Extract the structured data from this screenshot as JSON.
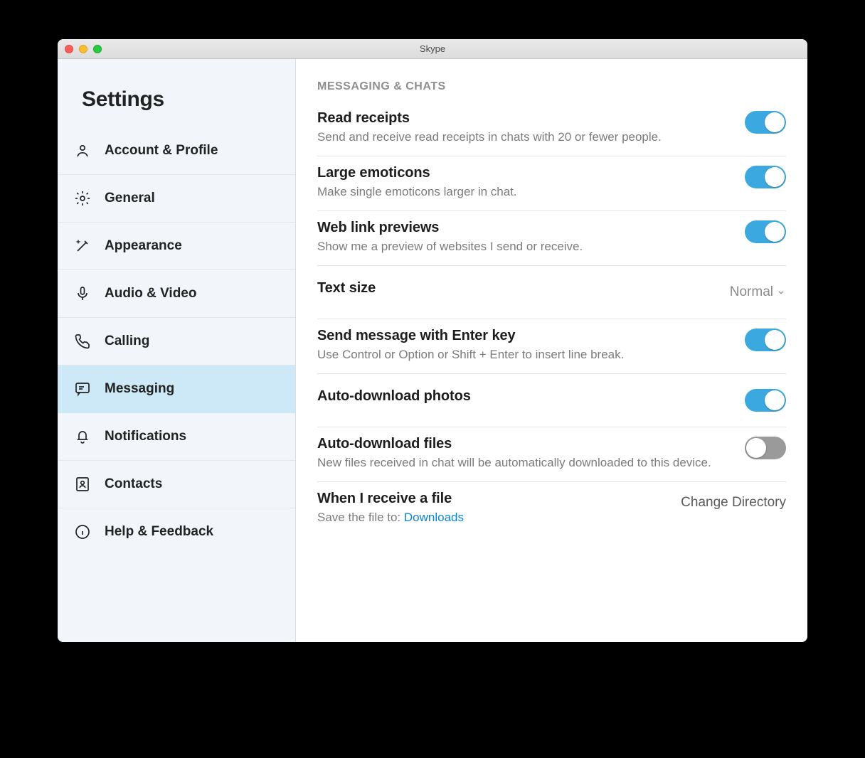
{
  "window": {
    "title": "Skype"
  },
  "sidebar": {
    "title": "Settings",
    "items": [
      {
        "label": "Account & Profile"
      },
      {
        "label": "General"
      },
      {
        "label": "Appearance"
      },
      {
        "label": "Audio & Video"
      },
      {
        "label": "Calling"
      },
      {
        "label": "Messaging"
      },
      {
        "label": "Notifications"
      },
      {
        "label": "Contacts"
      },
      {
        "label": "Help & Feedback"
      }
    ]
  },
  "content": {
    "section_header": "MESSAGING & CHATS",
    "read_receipts": {
      "title": "Read receipts",
      "desc": "Send and receive read receipts in chats with 20 or fewer people."
    },
    "large_emoticons": {
      "title": "Large emoticons",
      "desc": "Make single emoticons larger in chat."
    },
    "web_link_previews": {
      "title": "Web link previews",
      "desc": "Show me a preview of websites I send or receive."
    },
    "text_size": {
      "title": "Text size",
      "value": "Normal"
    },
    "send_enter": {
      "title": "Send message with Enter key",
      "desc": "Use Control or Option or Shift + Enter to insert line break."
    },
    "auto_photos": {
      "title": "Auto-download photos"
    },
    "auto_files": {
      "title": "Auto-download files",
      "desc": "New files received in chat will be automatically downloaded to this device."
    },
    "receive_file": {
      "title": "When I receive a file",
      "desc_prefix": "Save the file to: ",
      "desc_link": "Downloads",
      "action": "Change Directory"
    }
  }
}
